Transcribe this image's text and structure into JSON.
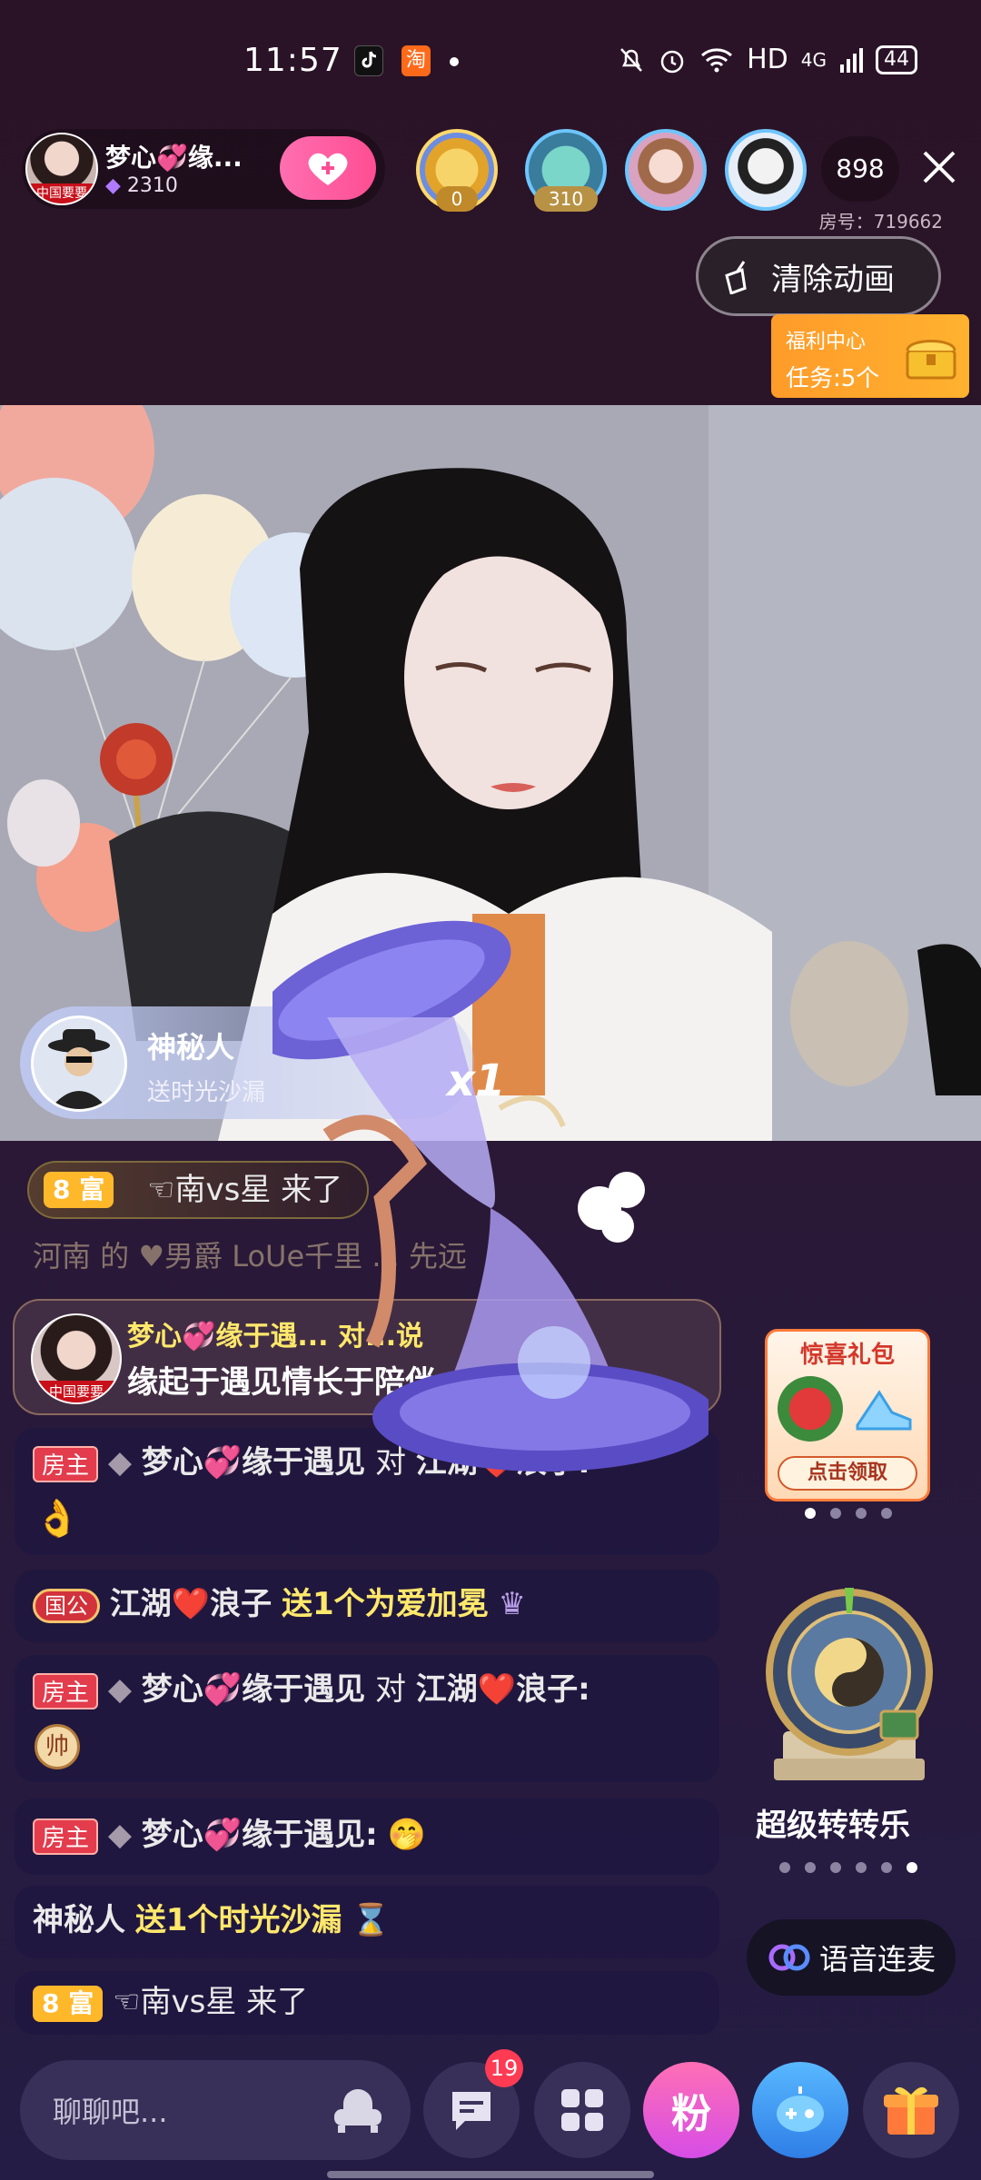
{
  "status_bar": {
    "time": "11:57",
    "hd": "HD",
    "network": "4G",
    "battery": "44"
  },
  "host": {
    "name": "梦心💞缘...",
    "fans": "2310",
    "avatar_tag": "中国要要"
  },
  "viewers": {
    "first_badge": "0",
    "second_badge": "310",
    "count": "898"
  },
  "room": {
    "number": "房号：719662"
  },
  "buttons": {
    "clear_animation": "清除动画"
  },
  "welfare": {
    "title": "福利中心",
    "task": "任务:5个"
  },
  "gift_toast": {
    "sender": "神秘人",
    "desc": "送时光沙漏",
    "multiplier": "x1"
  },
  "enter_banner": {
    "level": "8 富",
    "text": "☜南vs星 来了"
  },
  "ghost_line": {
    "text": "河南 的 ♥男爵 LoUe千里 ... 先远"
  },
  "anchor_message": {
    "name": "梦心💞缘于遇... 对...说",
    "text": "缘起于遇见情长于陪伴",
    "avatar_tag": "中国要要"
  },
  "chat": [
    {
      "tag": "房主",
      "name": "梦心💞缘于遇见",
      "connector": "对",
      "target": "江湖❤️浪子:",
      "content": "👌"
    },
    {
      "tag": "国公",
      "name": "江湖❤️浪子",
      "gift": "送1个为爱加冕"
    },
    {
      "tag": "房主",
      "name": "梦心💞缘于遇见",
      "connector": "对",
      "target": "江湖❤️浪子:",
      "content": "帅"
    },
    {
      "tag": "房主",
      "name": "梦心💞缘于遇见:",
      "content": "🤭"
    },
    {
      "name": "神秘人",
      "gift": "送1个时光沙漏"
    },
    {
      "level": "8 富",
      "text": "☜南vs星 来了"
    }
  ],
  "surprise_pack": {
    "title": "惊喜礼包",
    "action": "点击领取"
  },
  "wheel": {
    "label": "超级转转乐"
  },
  "voice_link": {
    "label": "语音连麦"
  },
  "input": {
    "placeholder": "聊聊吧..."
  },
  "bottom_bar": {
    "message_badge": "19",
    "fan_label": "粉"
  }
}
